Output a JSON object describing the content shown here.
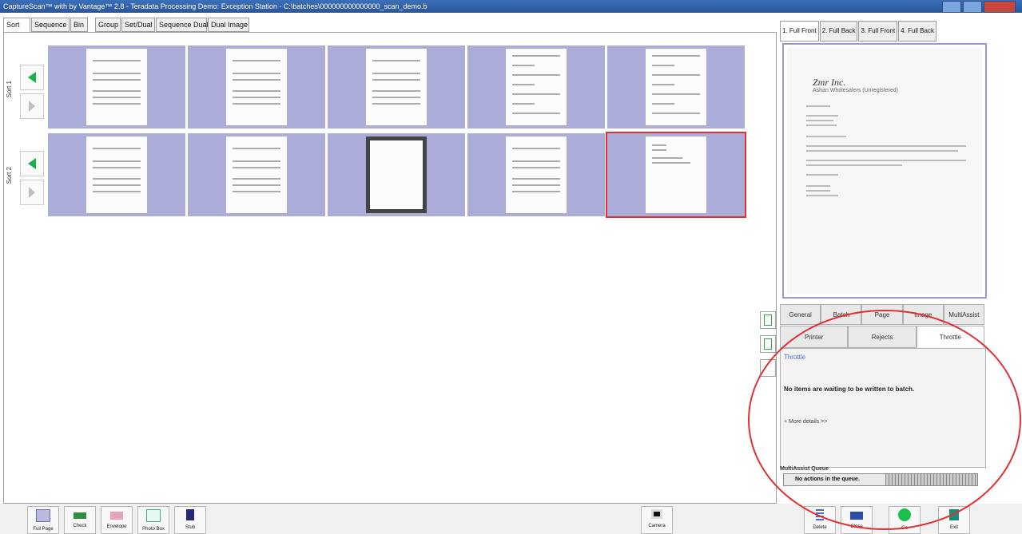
{
  "window": {
    "title": "CaptureScan™ with by Vantage™ 2.8 - Teradata Processing Demo: Exception Station - C:\\batches\\000000000000000_scan_demo.b"
  },
  "top_tabs": [
    "Sort",
    "Sequence",
    "Bin",
    "Group",
    "Set/Dual",
    "Sequence Dual",
    "Dual Image"
  ],
  "sorts": [
    {
      "label": "Sort 1"
    },
    {
      "label": "Sort 2"
    }
  ],
  "thumbnail_rows": [
    {
      "items": [
        "letter",
        "letter",
        "letter",
        "form",
        "form"
      ]
    },
    {
      "items": [
        "letter",
        "letter",
        "frame",
        "letter",
        "blank-memo"
      ]
    }
  ],
  "selected_thumbnail": "row2-item5",
  "right_tabs": [
    "1. Full Front",
    "2. Full Back",
    "3. Full Front",
    "4. Full Back"
  ],
  "preview": {
    "heading": "Zmr Inc.",
    "subheading": "Ashan Wholesalers (Unregistered)"
  },
  "panel_tabs_row1": [
    "General",
    "Batch",
    "Page",
    "Image",
    "MultiAssist"
  ],
  "panel_tabs_row2": [
    "Printer",
    "Rejects",
    "Throttle"
  ],
  "active_panel_tab": "Throttle",
  "throttle": {
    "title": "Throttle",
    "message": "No items are waiting to be written to batch.",
    "more": "+ More details >>"
  },
  "multiassist": {
    "title": "MultiAssist Queue",
    "status": "No actions in the queue."
  },
  "bottom_left_buttons": [
    "Full Page",
    "Check",
    "Envelope",
    "Photo Box",
    "Stub"
  ],
  "bottom_center_button": "Camera",
  "bottom_right_buttons": [
    "Delete",
    "Close",
    "Go",
    "Exit"
  ],
  "colors": {
    "thumbnail_bg": "#acacd8",
    "selection": "#e23030",
    "accent_green": "#18b24a",
    "annotation_circle": "#e23030"
  }
}
